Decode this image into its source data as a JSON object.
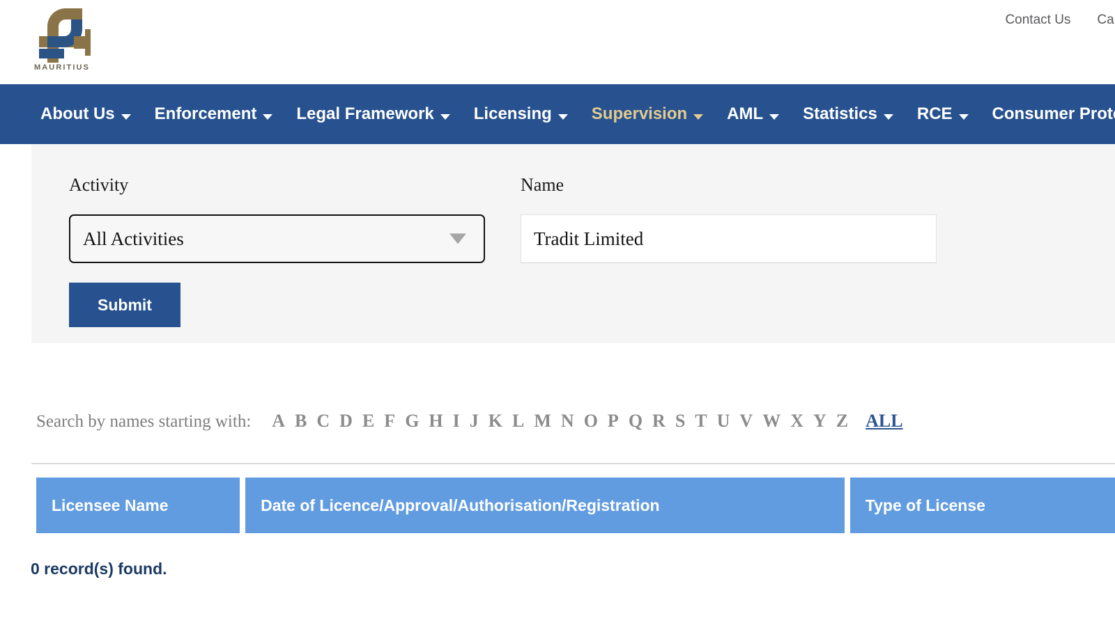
{
  "header": {
    "logo": {
      "name": "fsc-mauritius-logo",
      "wordmark": "MAURITIUS",
      "gold": "#8a7346",
      "navy": "#2b5384"
    },
    "utility_links": [
      {
        "label": "Contact Us"
      },
      {
        "label": "Careers"
      }
    ]
  },
  "nav": {
    "background": "#27528f",
    "active_color": "#e2cb8f",
    "items": [
      {
        "label": "About Us",
        "active": false,
        "has_caret": true
      },
      {
        "label": "Enforcement",
        "active": false,
        "has_caret": true
      },
      {
        "label": "Legal Framework",
        "active": false,
        "has_caret": true
      },
      {
        "label": "Licensing",
        "active": false,
        "has_caret": true
      },
      {
        "label": "Supervision",
        "active": true,
        "has_caret": true
      },
      {
        "label": "AML",
        "active": false,
        "has_caret": true
      },
      {
        "label": "Statistics",
        "active": false,
        "has_caret": true
      },
      {
        "label": "RCE",
        "active": false,
        "has_caret": true
      },
      {
        "label": "Consumer Protection",
        "active": false,
        "has_caret": true
      }
    ]
  },
  "filter": {
    "activity_label": "Activity",
    "activity_value": "All Activities",
    "name_label": "Name",
    "name_value": "Tradit Limited",
    "name_placeholder": "",
    "submit_label": "Submit",
    "submit_color": "#27528f"
  },
  "alphabet": {
    "caption": "Search by names starting with:",
    "letters": [
      "A",
      "B",
      "C",
      "D",
      "E",
      "F",
      "G",
      "H",
      "I",
      "J",
      "K",
      "L",
      "M",
      "N",
      "O",
      "P",
      "Q",
      "R",
      "S",
      "T",
      "U",
      "V",
      "W",
      "X",
      "Y",
      "Z"
    ],
    "all_label": "ALL",
    "all_color": "#2b5490",
    "letter_color": "#8c8c8c"
  },
  "results": {
    "header_color": "#629ce0",
    "columns": [
      {
        "label": "Licensee Name"
      },
      {
        "label": "Date of Licence/Approval/Authorisation/Registration"
      },
      {
        "label": "Type of License"
      }
    ],
    "rows": [],
    "record_count_text": "0 record(s) found."
  }
}
